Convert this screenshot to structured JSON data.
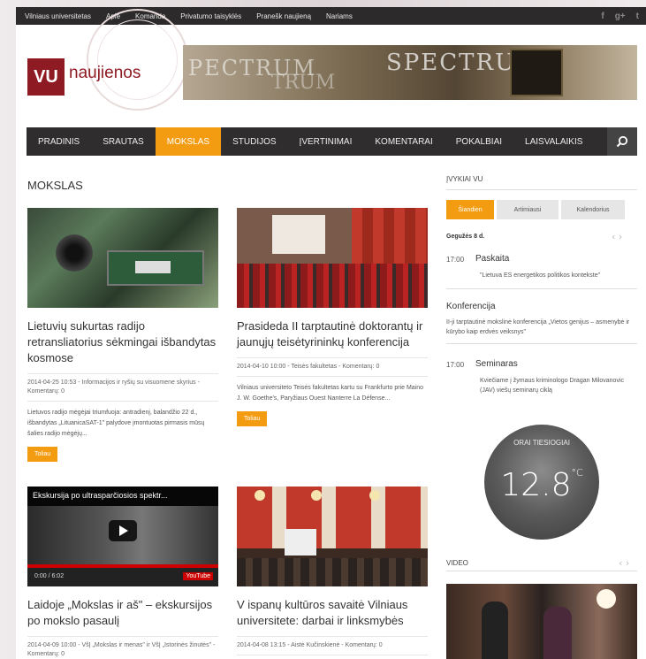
{
  "topbar": {
    "links": [
      "Vilniaus universitetas",
      "Apie",
      "Komanda",
      "Privatumo taisyklės",
      "Pranešk naujieną",
      "Nariams"
    ],
    "social": [
      "facebook-icon",
      "google-plus-icon",
      "twitter-icon"
    ]
  },
  "header": {
    "logo_mark": "VU",
    "logo_text": "naujienos",
    "banner_words": [
      "PECTRUM",
      "TRUM",
      "SPECTRUM"
    ]
  },
  "nav": {
    "items": [
      "PRADINIS",
      "SRAUTAS",
      "MOKSLAS",
      "STUDIJOS",
      "ĮVERTINIMAI",
      "KOMENTARAI",
      "POKALBIAI",
      "LAISVALAIKIS"
    ],
    "active_index": 2,
    "search_icon": "search-icon"
  },
  "section": {
    "title": "MOKSLAS"
  },
  "articles": [
    {
      "title": "Lietuvių sukurtas radijo retransliatorius sėkmingai išbandytas kosmose",
      "meta": "2014-04-25 10:53 - Informacijos ir ryšių su visuomene skyrius - Komentarų: 0",
      "excerpt": "Lietuvos radijo mėgėjai triumfuoja: antradienį, balandžio 22 d., išbandytas „LituanicaSAT-1\" palydove įmontuotas pirmasis mūsų šalies radijo mėgėjų...",
      "button": "Toliau"
    },
    {
      "title": "Prasideda II tarptautinė doktorantų ir jaunųjų teisėtyrininkų konferencija",
      "meta": "2014-04-10 10:00 - Teisės fakultetas - Komentarų: 0",
      "excerpt": "Vilniaus universiteto Teisės fakultetas kartu su Frankfurto prie Maino J. W. Goethe's, Paryžiaus Ouest Nanterre La Défense...",
      "button": "Toliau"
    },
    {
      "title": "Laidoje „Mokslas ir aš\" – ekskursijos po mokslo pasaulį",
      "meta": "2014-04-09 10:00 - VšĮ „Mokslas ir menas\" ir VšĮ „Istorinės žinutės\" - Komentarų: 0",
      "video_title": "Ekskursija po ultrasparčiosios spektr...",
      "video_time": "0:00 / 6:02",
      "video_brand": "YouTube"
    },
    {
      "title": "V ispanų kultūros savaitė Vilniaus universitete: darbai ir linksmybės",
      "meta": "2014-04-08 13:15 - Aistė Kučinskienė - Komentarų: 0"
    }
  ],
  "sidebar": {
    "events_label": "ĮVYKIAI VU",
    "tabs": [
      "Šiandien",
      "Artimiausi",
      "Kalendorius"
    ],
    "active_tab": 0,
    "date": "Gegužės 8 d.",
    "events": [
      {
        "time": "17:00",
        "title": "Paskaita",
        "desc": "\"Lietuva ES energetikos politikos kontekste\""
      },
      {
        "time": "",
        "title": "Konferencija",
        "desc": "II-ji tarptautinė mokslinė konferencija „Vietos genijus – asmenybė ir kūrybo kaip erdvės veiksnys\""
      },
      {
        "time": "17:00",
        "title": "Seminaras",
        "desc": "Kviečiame į žymaus kriminologo Dragan Milovanovic (JAV) viešų seminarų ciklą"
      }
    ],
    "weather_label": "ORAI TIESIOGIAI",
    "temperature": "12.8",
    "temperature_unit": "°C",
    "video_label": "VIDEO"
  }
}
